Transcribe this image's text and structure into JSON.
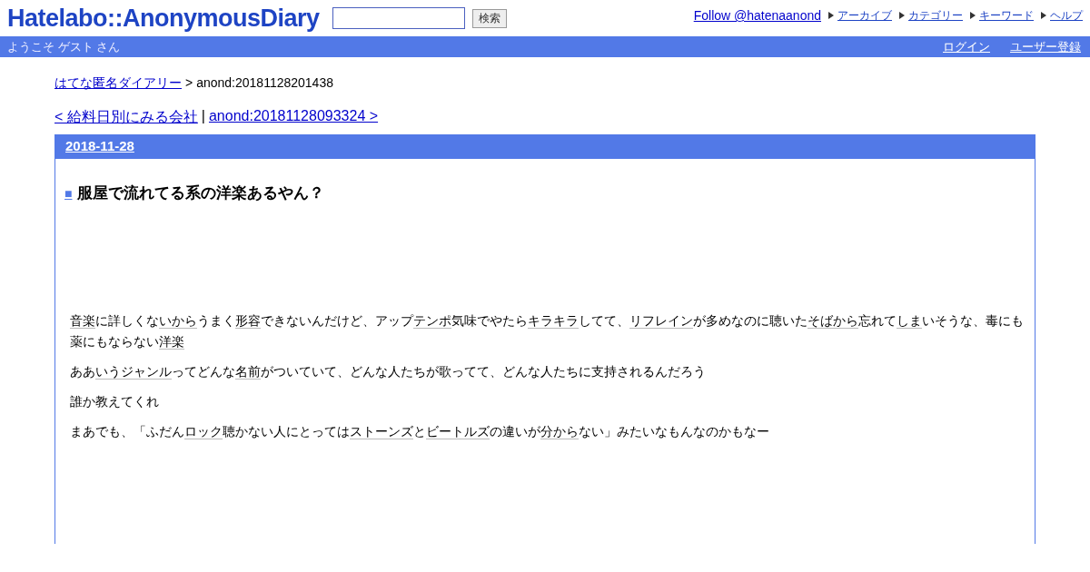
{
  "header": {
    "logo": "Hatelabo::AnonymousDiary",
    "search_button": "検索",
    "follow_link": "Follow @hatenaanond",
    "nav_links": [
      "アーカイブ",
      "カテゴリー",
      "キーワード",
      "ヘルプ"
    ]
  },
  "user_bar": {
    "greeting": "ようこそ ゲスト さん",
    "links": [
      "ログイン",
      "ユーザー登録"
    ]
  },
  "breadcrumb": {
    "link": "はてな匿名ダイアリー",
    "separator": ">",
    "current": "anond:20181128201438"
  },
  "pager": {
    "prev": "< 給料日別にみる会社",
    "separator": "|",
    "next": "anond:20181128093324 >"
  },
  "day": {
    "date": "2018-11-28",
    "section_mark": "■",
    "title": "服屋で流れてる系の洋楽あるやん？",
    "paragraphs": [
      [
        {
          "text": "音楽",
          "keyword": true
        },
        {
          "text": "に詳しくな",
          "keyword": false
        },
        {
          "text": "いから",
          "keyword": true
        },
        {
          "text": "うまく",
          "keyword": false
        },
        {
          "text": "形容",
          "keyword": true
        },
        {
          "text": "できないんだけど、アップ",
          "keyword": false
        },
        {
          "text": "テンポ",
          "keyword": true
        },
        {
          "text": "気味でやたら",
          "keyword": false
        },
        {
          "text": "キラキラ",
          "keyword": true
        },
        {
          "text": "してて、",
          "keyword": false
        },
        {
          "text": "リフレイン",
          "keyword": true
        },
        {
          "text": "が多めなのに聴いた",
          "keyword": false
        },
        {
          "text": "そばから",
          "keyword": true
        },
        {
          "text": "忘れて",
          "keyword": false
        },
        {
          "text": "しま",
          "keyword": true
        },
        {
          "text": "いそうな、毒にも薬にもならない",
          "keyword": false
        },
        {
          "text": "洋楽",
          "keyword": true
        }
      ],
      [
        {
          "text": "ああ",
          "keyword": false
        },
        {
          "text": "いう",
          "keyword": true
        },
        {
          "text": "ジャンル",
          "keyword": true
        },
        {
          "text": "ってどんな",
          "keyword": false
        },
        {
          "text": "名前",
          "keyword": true
        },
        {
          "text": "がついていて、どんな人たちが歌ってて、どんな人たちに支持されるんだろう",
          "keyword": false
        }
      ],
      [
        {
          "text": "誰か教えてくれ",
          "keyword": false
        }
      ],
      [
        {
          "text": "まあでも、「ふだん",
          "keyword": false
        },
        {
          "text": "ロック",
          "keyword": true
        },
        {
          "text": "聴かない人にとっては",
          "keyword": false
        },
        {
          "text": "ストーンズ",
          "keyword": true
        },
        {
          "text": "と",
          "keyword": false
        },
        {
          "text": "ビートルズ",
          "keyword": true
        },
        {
          "text": "の違いが",
          "keyword": false
        },
        {
          "text": "分から",
          "keyword": true
        },
        {
          "text": "ない」みたいなもんなのかもなー",
          "keyword": false
        }
      ]
    ]
  }
}
